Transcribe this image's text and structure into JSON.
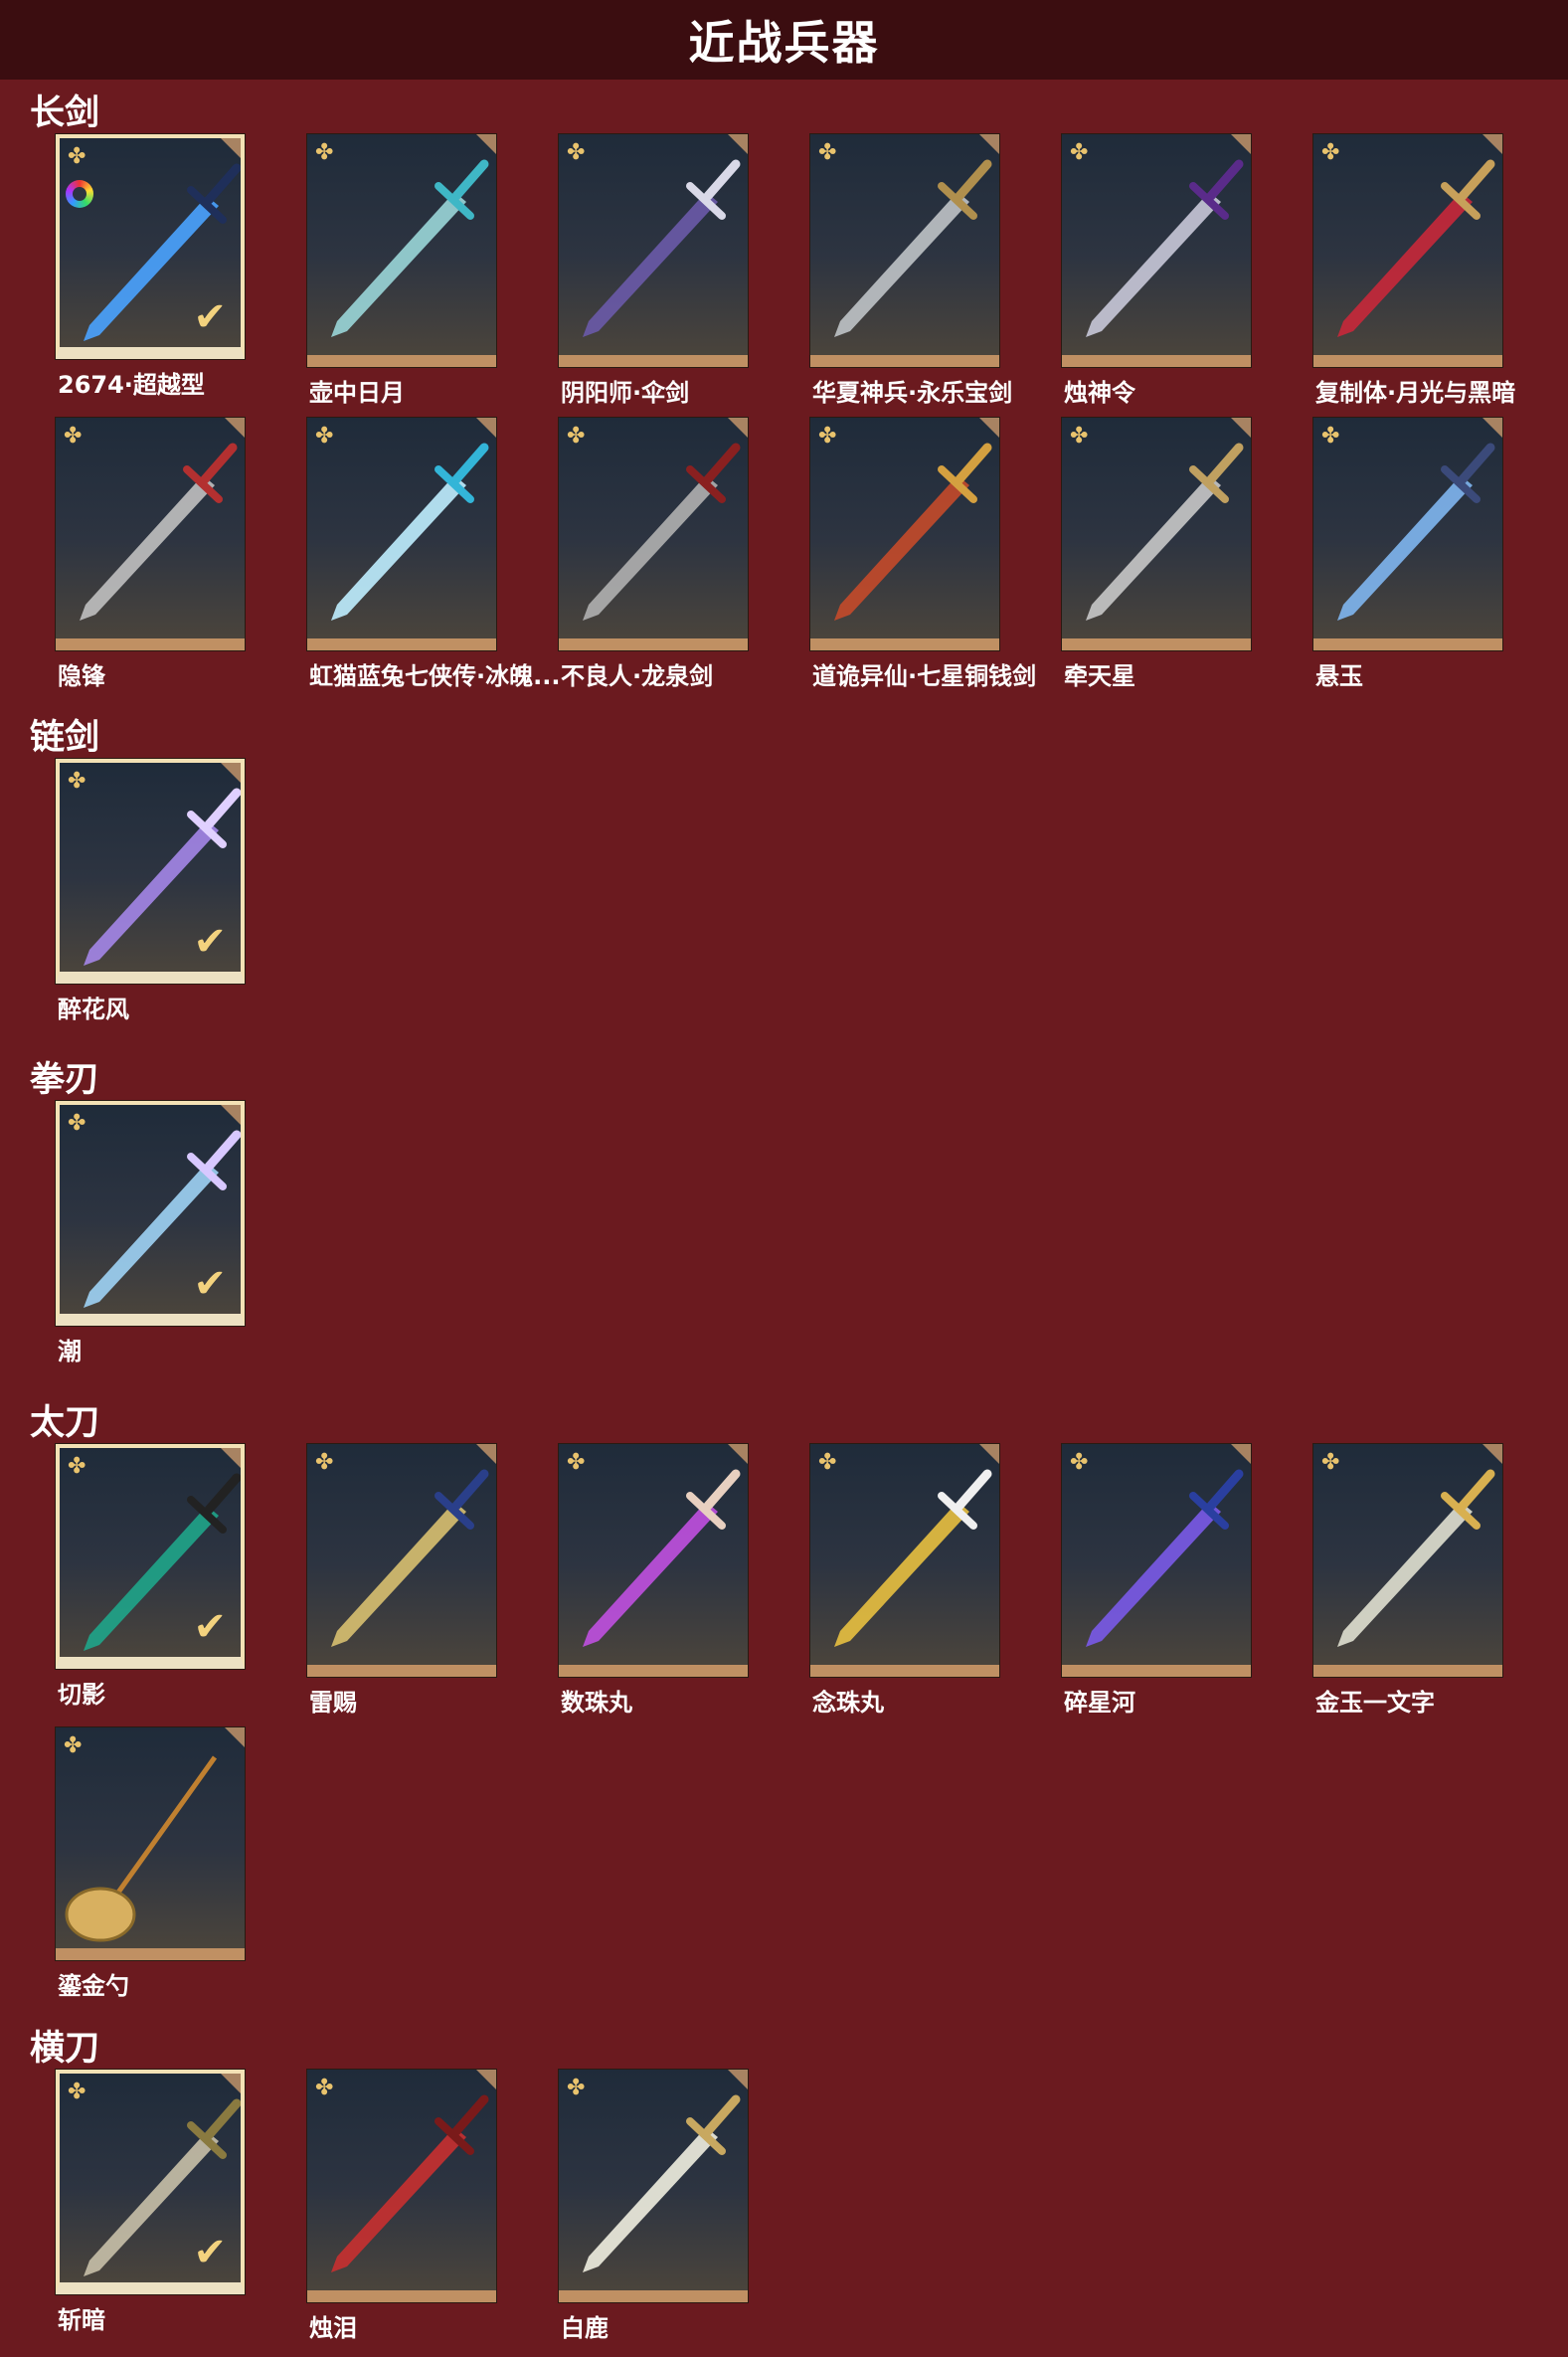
{
  "header": {
    "title": "近战兵器"
  },
  "sections": [
    {
      "title": "长剑",
      "items": [
        {
          "name": "2674·超越型",
          "selected": true,
          "dyed": true,
          "blade": "#4aa3ff",
          "hilt": "#1f2f5a"
        },
        {
          "name": "壶中日月",
          "blade": "#9ad6d8",
          "hilt": "#3fb7c6"
        },
        {
          "name": "阴阳师·伞剑",
          "blade": "#6a5aa8",
          "hilt": "#d9d9e8"
        },
        {
          "name": "华夏神兵·永乐宝剑",
          "blade": "#bfc3c6",
          "hilt": "#b08f4d"
        },
        {
          "name": "烛神令",
          "blade": "#c8c8d8",
          "hilt": "#5a2b8a"
        },
        {
          "name": "复制体·月光与黑暗",
          "blade": "#c8283a",
          "hilt": "#c7a05a"
        },
        {
          "name": "隐锋",
          "blade": "#c0c0c0",
          "hilt": "#b33030"
        },
        {
          "name": "虹猫蓝兔七侠传·冰魄...",
          "blade": "#bfeeff",
          "hilt": "#33b5d8"
        },
        {
          "name": "不良人·龙泉剑",
          "blade": "#b0b0b0",
          "hilt": "#8a2020"
        },
        {
          "name": "道诡异仙·七星铜钱剑",
          "blade": "#c44a2a",
          "hilt": "#d4a040"
        },
        {
          "name": "牵天星",
          "blade": "#c8c8c8",
          "hilt": "#c0a060"
        },
        {
          "name": "悬玉",
          "blade": "#7fb6f0",
          "hilt": "#3b4a7a"
        }
      ]
    },
    {
      "title": "链剑",
      "items": [
        {
          "name": "醉花风",
          "selected": true,
          "blade": "#a486e8",
          "hilt": "#e0d0ff"
        }
      ]
    },
    {
      "title": "拳刃",
      "items": [
        {
          "name": "潮",
          "selected": true,
          "blade": "#9fd3f5",
          "hilt": "#d8c8ff"
        }
      ]
    },
    {
      "title": "太刀",
      "items": [
        {
          "name": "切影",
          "selected": true,
          "blade": "#1fa58a",
          "hilt": "#222222"
        },
        {
          "name": "雷赐",
          "blade": "#d8c070",
          "hilt": "#2a3f8a"
        },
        {
          "name": "数珠丸",
          "blade": "#c050e0",
          "hilt": "#e8d0c0"
        },
        {
          "name": "念珠丸",
          "blade": "#e8c040",
          "hilt": "#f0f0f0"
        },
        {
          "name": "碎星河",
          "blade": "#7a5ae8",
          "hilt": "#2a3fa0"
        },
        {
          "name": "金玉一文字",
          "blade": "#e0e0d0",
          "hilt": "#d8b050"
        },
        {
          "name": "鎏金勺",
          "blade": "#d8b060",
          "hilt": "#c08030",
          "spoon": true
        }
      ]
    },
    {
      "title": "横刀",
      "items": [
        {
          "name": "斩暗",
          "selected": true,
          "blade": "#c8c0a8",
          "hilt": "#8a7a40"
        },
        {
          "name": "烛泪",
          "blade": "#c83030",
          "hilt": "#7a1a1a"
        },
        {
          "name": "白鹿",
          "blade": "#f0eee0",
          "hilt": "#c8a860"
        }
      ]
    }
  ]
}
